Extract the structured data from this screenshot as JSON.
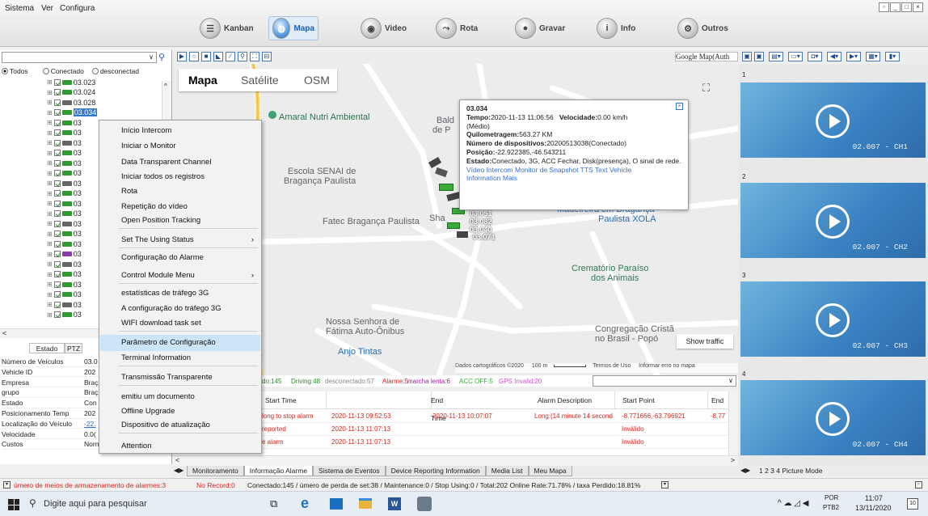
{
  "menubar": {
    "items": [
      "Sistema",
      "Ver",
      "Configura"
    ]
  },
  "nav": {
    "items": [
      {
        "label": "Kanban",
        "active": false
      },
      {
        "label": "Mapa",
        "active": true
      },
      {
        "label": "Video",
        "active": false
      },
      {
        "label": "Rota",
        "active": false
      },
      {
        "label": "Gravar",
        "active": false
      },
      {
        "label": "Info",
        "active": false
      },
      {
        "label": "Outros",
        "active": false
      }
    ]
  },
  "left": {
    "filter": {
      "all": "Todos",
      "connected": "Conectado",
      "disconnected": "desconectad"
    },
    "tree": [
      "03.023",
      "03.024",
      "03.028",
      "03.034",
      "03",
      "03",
      "03",
      "03",
      "03",
      "03",
      "03",
      "03",
      "03",
      "03",
      "03",
      "03",
      "03",
      "03",
      "03",
      "03",
      "03",
      "03",
      "03",
      "03"
    ],
    "tabs": {
      "estado": "Estado",
      "ptz": "PTZ"
    },
    "props": [
      {
        "k": "Número de Veículos",
        "v": "03.0"
      },
      {
        "k": "Vehicle ID",
        "v": "202"
      },
      {
        "k": "Empresa",
        "v": "Braç"
      },
      {
        "k": "grupo",
        "v": "Braç"
      },
      {
        "k": "Estado",
        "v": "Con"
      },
      {
        "k": "Posicionamento Temp",
        "v": "202"
      },
      {
        "k": "Localização do Veículo",
        "v": "-22."
      },
      {
        "k": "Velocidade",
        "v": "0.0("
      },
      {
        "k": "Custos",
        "v": "Normal"
      }
    ]
  },
  "context_menu": {
    "items": [
      {
        "label": "Início Intercom",
        "sep_after": false
      },
      {
        "label": "Iniciar o Monitor",
        "sep_after": false
      },
      {
        "label": "Data Transparent Channel",
        "sep_after": false
      },
      {
        "label": "Iniciar todos os registros",
        "sep_after": false
      },
      {
        "label": "Rota",
        "sep_after": false
      },
      {
        "label": "Repetição do vídeo",
        "sep_after": false
      },
      {
        "label": "Open Position Tracking",
        "sep_after": true
      },
      {
        "label": "Set The Using Status",
        "arrow": true,
        "sep_after": true
      },
      {
        "label": "Configuração do Alarme",
        "sep_after": false
      },
      {
        "label": "Control Module Menu",
        "arrow": true,
        "sep_after": true
      },
      {
        "label": "estatísticas de tráfego 3G",
        "sep_after": false
      },
      {
        "label": "A configuração do tráfego 3G",
        "sep_after": false
      },
      {
        "label": "WIFI download task set",
        "sep_after": true
      },
      {
        "label": "Parâmetro de Configuração",
        "highlight": true,
        "sep_after": false
      },
      {
        "label": "Terminal Information",
        "sep_after": true
      },
      {
        "label": "Transmissão Transparente",
        "sep_after": true
      },
      {
        "label": "emitiu um documento",
        "sep_after": false
      },
      {
        "label": "Offline Upgrade",
        "sep_after": false
      },
      {
        "label": "Dispositivo de atualização",
        "sep_after": true
      },
      {
        "label": "Attention",
        "sep_after": false
      }
    ]
  },
  "map": {
    "provider": "Google Map(Auth",
    "types": [
      "Mapa",
      "Satélite",
      "OSM"
    ],
    "places": [
      "Amaral Nutri Ambiental",
      "Escola SENAI de",
      "Bragança Paulista",
      "Fatec Bragança Paulista",
      "Crematório Paraíso",
      "dos Animais",
      "Madeireira em Bragança",
      "Paulista XOLA",
      "Nossa Senhora de",
      "Fátima Auto-Ônibus",
      "Anjo Tintas",
      "Congregação Cristã",
      "no Brasil - Popó",
      "Bald",
      "de P",
      "Sha"
    ],
    "vehicle_labels": [
      "03.051",
      "03.082",
      "03.040",
      "03.071"
    ],
    "show_traffic": "Show traffic",
    "footer": {
      "data": "Dados cartográficos ©2020",
      "scale": "100 m",
      "terms": "Termos de Uso",
      "report": "Informar erro no mapa"
    }
  },
  "infowindow": {
    "title": "03.034",
    "tempo_label": "Tempo:",
    "tempo": "2020-11-13 11:06:56",
    "vel_label": "Velocidade:",
    "vel": "0.00 km/h",
    "medio": "(Médio)",
    "km_label": "Quilometragem:",
    "km": "563.27 KM",
    "dev_label": "Número de dispositivos:",
    "dev": "20200513038(Conectado)",
    "pos_label": "Posição:",
    "pos": "-22.922385,-46.543211",
    "est_label": "Estado:",
    "est": "Conectado, 3G, ACC Fechar, Disk(presença), O sinal de rede.",
    "links1": "Vídeo  Intercom  Monitor de  Snapshot  TTS Text  Vehicle",
    "links2": "Information  Mais"
  },
  "stats": {
    "online": "do:145",
    "driving": "Driving:48",
    "disconnected": "desconectado:57",
    "alarm": "Alarme:5",
    "idle": "marcha lenta:6",
    "acc": "ACC OFF:5",
    "gps": "GPS Invalid:20"
  },
  "alarm_table": {
    "headers": [
      "Start Time",
      "End Time",
      "Alarm Description",
      "Start Point",
      "End"
    ],
    "rows": [
      {
        "type": "long to stop alarm",
        "start": "2020-11-13 09:52:53",
        "end": "2020-11-13 10:07:07",
        "desc": "Long:(14 minute 14 second",
        "point": "-8.771666,-63.796921",
        "endp": "-8.77"
      },
      {
        "type": "reported",
        "start": "2020-11-13 11:07:13",
        "end": "",
        "desc": "",
        "point": "Inválido",
        "endp": ""
      },
      {
        "type": "e alarm",
        "start": "2020-11-13 11:07:13",
        "end": "",
        "desc": "",
        "point": "Inválido",
        "endp": ""
      }
    ]
  },
  "bottom_tabs": [
    "Monitoramento",
    "Informação Alarme",
    "Sistema de Eventos",
    "Device Reporting Information",
    "Media List",
    "Meu Mapa"
  ],
  "cameras": [
    {
      "num": "1",
      "label": "02.007 - CH1"
    },
    {
      "num": "2",
      "label": "02.007 - CH2"
    },
    {
      "num": "3",
      "label": "02.007 - CH3"
    },
    {
      "num": "4",
      "label": "02.007 - CH4"
    }
  ],
  "cam_tabs": "1  2  3  4  Picture Mode",
  "status": {
    "storage": "úmero de meios de armazenamento de alarmes:3",
    "norecord": "No Record:0",
    "summary": "Conectado:145 / úmero de perda de set:38 / Maintenance:0 / Stop Using:0 / Total:202   Online Rate:71.78% / taxa Perdido:18.81%"
  },
  "taskbar": {
    "search": "Digite aqui para pesquisar",
    "lang": "POR",
    "lang2": "PTB2",
    "time": "11:07",
    "date": "13/11/2020",
    "notif": "10"
  },
  "colors": {
    "accent": "#1c5fb2",
    "alarm": "#d8241c",
    "cam": "#3a82c2",
    "highlight": "#cce4f7"
  }
}
